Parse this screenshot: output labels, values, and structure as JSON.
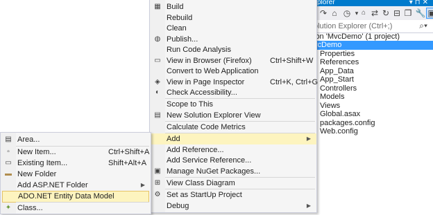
{
  "solution_explorer": {
    "title": "xplorer",
    "search_placeholder": "olution Explorer (Ctrl+;)",
    "solution_line": "ion 'MvcDemo' (1 project)",
    "project": "vcDemo",
    "items": [
      {
        "label": "Properties",
        "icon": "wrench-icon"
      },
      {
        "label": "References",
        "icon": "references-icon"
      },
      {
        "label": "App_Data",
        "icon": "folder-icon"
      },
      {
        "label": "App_Start",
        "icon": "folder-icon"
      },
      {
        "label": "Controllers",
        "icon": "folder-icon"
      },
      {
        "label": "Models",
        "icon": "folder-icon"
      },
      {
        "label": "Views",
        "icon": "folder-icon"
      },
      {
        "label": "Global.asax",
        "icon": "file-icon"
      },
      {
        "label": "packages.config",
        "icon": "file-icon"
      },
      {
        "label": "Web.config",
        "icon": "file-icon"
      }
    ]
  },
  "context_menu": {
    "items": [
      {
        "label": "Build",
        "icon": "build-icon"
      },
      {
        "label": "Rebuild"
      },
      {
        "label": "Clean"
      },
      {
        "label": "Publish...",
        "icon": "publish-globe-icon"
      },
      {
        "label": "Run Code Analysis"
      },
      {
        "label": "View in Browser (Firefox)",
        "shortcut": "Ctrl+Shift+W",
        "icon": "browser-icon"
      },
      {
        "label": "Convert to Web Application"
      },
      {
        "label": "View in Page Inspector",
        "shortcut": "Ctrl+K, Ctrl+G",
        "icon": "page-inspector-icon"
      },
      {
        "label": "Check Accessibility...",
        "icon": "accessibility-icon"
      },
      {
        "label": "Scope to This"
      },
      {
        "label": "New Solution Explorer View",
        "icon": "new-view-icon"
      },
      {
        "label": "Calculate Code Metrics"
      },
      {
        "label": "Add"
      },
      {
        "label": "Add Reference..."
      },
      {
        "label": "Add Service Reference..."
      },
      {
        "label": "Manage NuGet Packages...",
        "icon": "nuget-icon"
      },
      {
        "label": "View Class Diagram",
        "icon": "class-diagram-icon"
      },
      {
        "label": "Set as StartUp Project",
        "icon": "gear-icon"
      },
      {
        "label": "Debug"
      }
    ]
  },
  "add_submenu": {
    "items": [
      {
        "label": "Area...",
        "icon": "area-icon"
      },
      {
        "label": "New Item...",
        "shortcut": "Ctrl+Shift+A",
        "icon": "new-item-icon"
      },
      {
        "label": "Existing Item...",
        "shortcut": "Shift+Alt+A",
        "icon": "existing-item-icon"
      },
      {
        "label": "New Folder",
        "icon": "new-folder-icon"
      },
      {
        "label": "Add ASP.NET Folder"
      },
      {
        "label": "ADO.NET Entity Data Model"
      },
      {
        "label": "Class...",
        "icon": "class-icon"
      }
    ]
  }
}
